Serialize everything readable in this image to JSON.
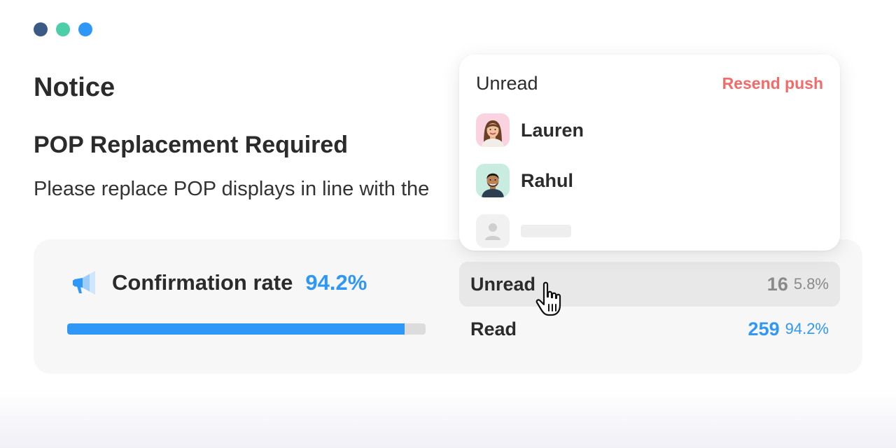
{
  "colors": {
    "dot1": "#3b5b86",
    "dot2": "#4ccfa8",
    "dot3": "#2f97f5",
    "accent_blue": "#2f97f5",
    "resend_red": "#f36a68",
    "muted_gray": "#8a8a8a",
    "track_gray": "#dcdcdc"
  },
  "window_controls": [
    "dot-dark-blue",
    "dot-teal",
    "dot-blue"
  ],
  "page": {
    "title": "Notice"
  },
  "notice": {
    "title": "POP Replacement Required",
    "body": "Please replace POP displays in line with the"
  },
  "stats": {
    "icon": "megaphone-icon",
    "rate_label": "Confirmation rate",
    "rate_value": "94.2%",
    "progress": 0.942,
    "unread": {
      "label": "Unread",
      "count": "16",
      "percent": "5.8%"
    },
    "read": {
      "label": "Read",
      "count": "259",
      "percent": "94.2%"
    }
  },
  "popover": {
    "title": "Unread",
    "action": "Resend push",
    "users": [
      {
        "name": "Lauren",
        "avatar": "woman-avatar"
      },
      {
        "name": "Rahul",
        "avatar": "man-avatar"
      }
    ],
    "placeholder_user": {
      "avatar": "person-placeholder-icon"
    }
  },
  "cursor": "pointer-hand-icon"
}
